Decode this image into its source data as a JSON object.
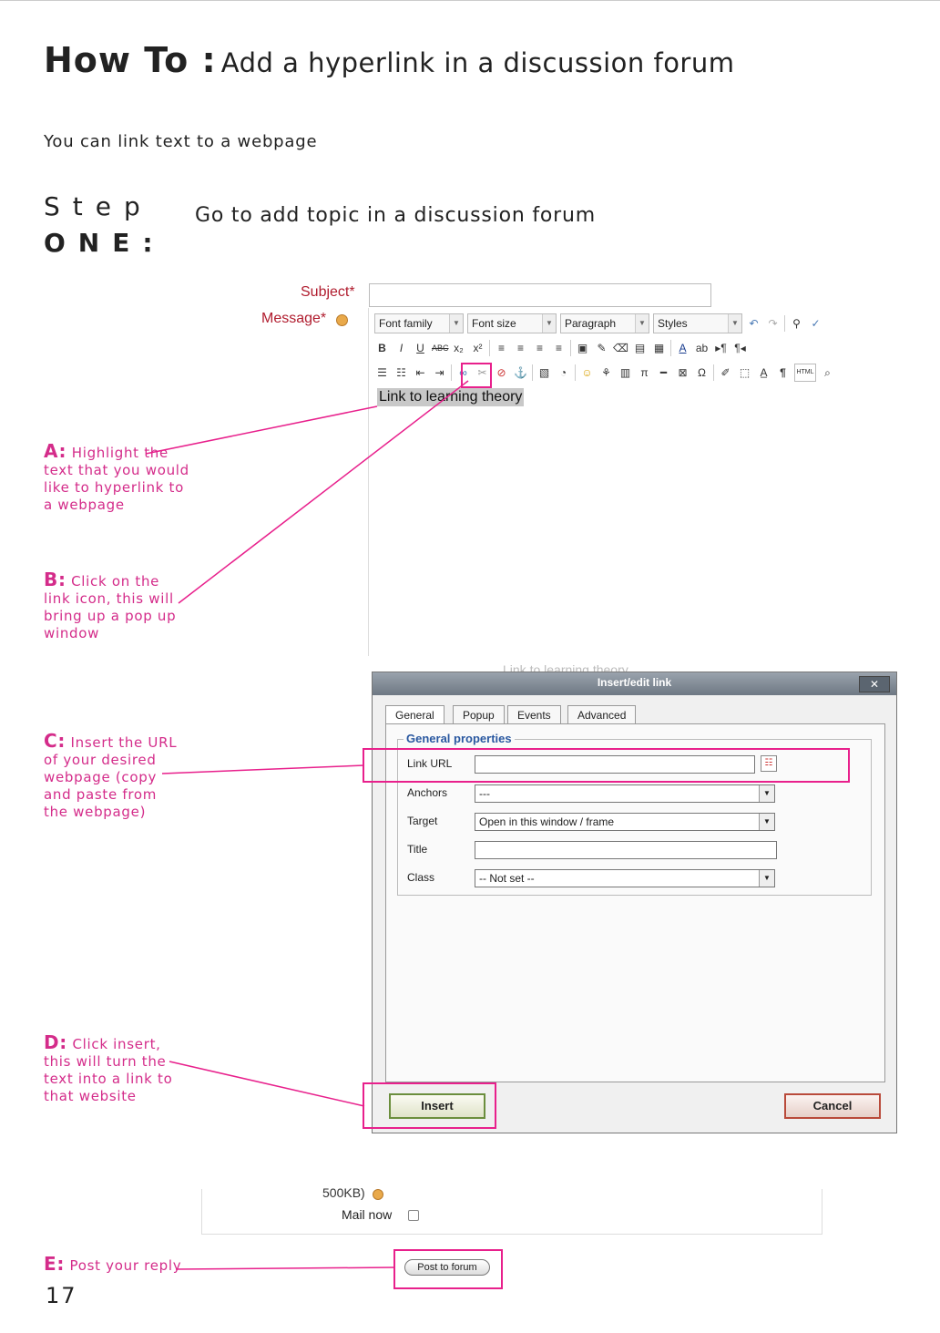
{
  "header": {
    "howto_bold": "How To :",
    "howto_rest": "Add a hyperlink in a discussion forum"
  },
  "intro": "You can link text to a webpage",
  "step": {
    "word": "Step",
    "number": "ONE:",
    "description": "Go to add topic in a discussion forum"
  },
  "notes": [
    {
      "letter": "A:",
      "text": "Highlight the text that you would like to hyperlink to a webpage"
    },
    {
      "letter": "B:",
      "text": "Click on the link icon, this will bring up a pop up window"
    },
    {
      "letter": "C:",
      "text": "Insert the URL of your desired webpage (copy and paste from the webpage)"
    },
    {
      "letter": "D:",
      "text": "Click insert, this will turn the text into a link to that website"
    },
    {
      "letter": "E:",
      "text": "Post your reply"
    }
  ],
  "form": {
    "subject_label": "Subject*",
    "message_label": "Message*",
    "subject_value": "",
    "toolbar_selects": [
      "Font family",
      "Font size",
      "Paragraph",
      "Styles"
    ],
    "highlighted_text": "Link to learning theory",
    "faded_text": "Link to learning theory"
  },
  "dialog": {
    "title": "Insert/edit link",
    "close": "✕",
    "tabs": [
      "General",
      "Popup",
      "Events",
      "Advanced"
    ],
    "legend": "General properties",
    "fields": {
      "link_url_label": "Link URL",
      "link_url_value": "",
      "anchors_label": "Anchors",
      "anchors_value": "---",
      "target_label": "Target",
      "target_value": "Open in this window / frame",
      "title_label": "Title",
      "title_value": "",
      "class_label": "Class",
      "class_value": "-- Not set --"
    },
    "insert": "Insert",
    "cancel": "Cancel"
  },
  "bottom": {
    "size_text": "500KB)",
    "mail_now": "Mail now",
    "post_button": "Post to forum"
  },
  "page_number": "17",
  "colors": {
    "accent_pink": "#e8208c",
    "label_red": "#b01c2e",
    "legend_blue": "#2a58a0"
  }
}
